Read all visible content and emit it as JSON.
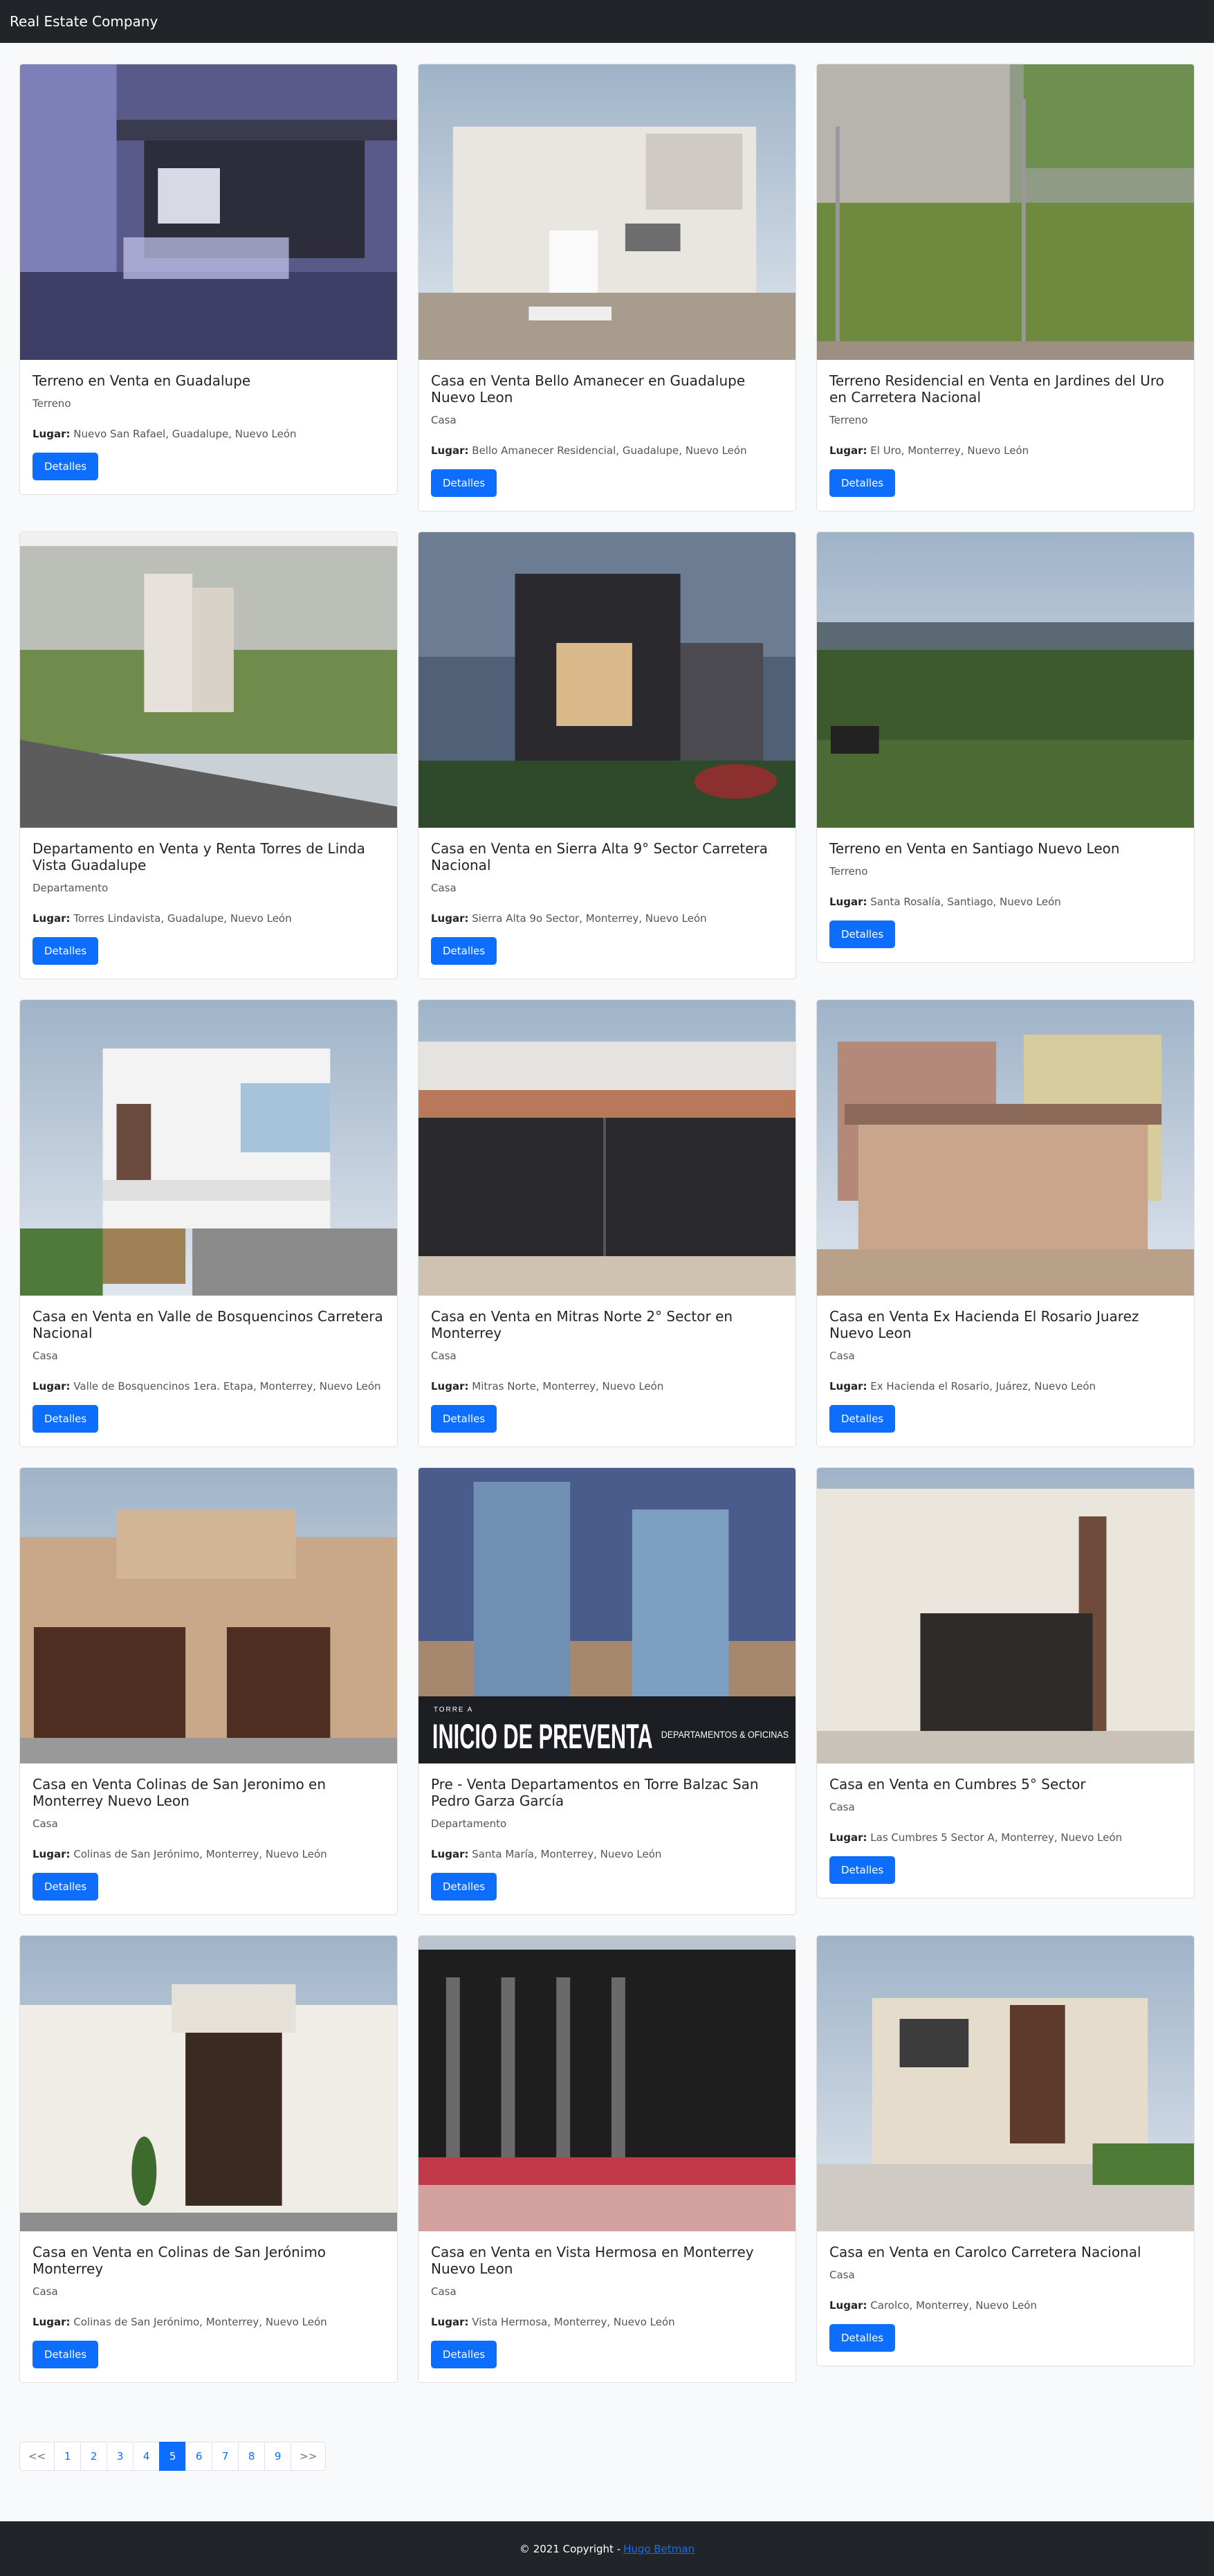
{
  "nav": {
    "brand": "Real Estate Company"
  },
  "card_labels": {
    "place_label": "Lugar:",
    "details_button": "Detalles"
  },
  "listings": [
    {
      "title": "Terreno en Venta en Guadalupe",
      "type": "Terreno",
      "place": "Nuevo San Rafael, Guadalupe, Nuevo León",
      "photo": "lot-warehouse"
    },
    {
      "title": "Casa en Venta Bello Amanecer en Guadalupe Nuevo Leon",
      "type": "Casa",
      "place": "Bello Amanecer Residencial, Guadalupe, Nuevo León",
      "photo": "house-modern-white"
    },
    {
      "title": "Terreno Residencial en Venta en Jardines del Uro en Carretera Nacional",
      "type": "Terreno",
      "place": "El Uro, Monterrey, Nuevo León",
      "photo": "lot-overgrown"
    },
    {
      "title": "Departamento en Venta y Renta Torres de Linda Vista Guadalupe",
      "type": "Departamento",
      "place": "Torres Lindavista, Guadalupe, Nuevo León",
      "photo": "aerial-towers"
    },
    {
      "title": "Casa en Venta en Sierra Alta 9° Sector Carretera Nacional",
      "type": "Casa",
      "place": "Sierra Alta 9o Sector, Monterrey, Nuevo León",
      "photo": "house-night-render"
    },
    {
      "title": "Terreno en Venta en Santiago Nuevo Leon",
      "type": "Terreno",
      "place": "Santa Rosalía, Santiago, Nuevo León",
      "photo": "lot-green-field"
    },
    {
      "title": "Casa en Venta en Valle de Bosquencinos Carretera Nacional",
      "type": "Casa",
      "place": "Valle de Bosquencinos 1era. Etapa, Monterrey, Nuevo León",
      "photo": "house-render-sky"
    },
    {
      "title": "Casa en Venta en Mitras Norte 2° Sector en Monterrey",
      "type": "Casa",
      "place": "Mitras Norte, Monterrey, Nuevo León",
      "photo": "house-garage-gate"
    },
    {
      "title": "Casa en Venta Ex Hacienda El Rosario Juarez Nuevo Leon",
      "type": "Casa",
      "place": "Ex Hacienda el Rosario, Juárez, Nuevo León",
      "photo": "house-small-two-story"
    },
    {
      "title": "Casa en Venta Colinas de San Jeronimo en Monterrey Nuevo Leon",
      "type": "Casa",
      "place": "Colinas de San Jerónimo, Monterrey, Nuevo León",
      "photo": "house-wood-doors"
    },
    {
      "title": "Pre - Venta Departamentos en Torre Balzac San Pedro Garza García",
      "type": "Departamento",
      "place": "Santa María, Monterrey, Nuevo León",
      "photo": "towers-presale",
      "overlay_small": "TORRE A",
      "overlay_big": "INICIO DE PREVENTA",
      "overlay_side": "DEPARTAMENTOS & OFICINAS"
    },
    {
      "title": "Casa en Venta en Cumbres 5° Sector",
      "type": "Casa",
      "place": "Las Cumbres 5 Sector A, Monterrey, Nuevo León",
      "photo": "house-white-garage"
    },
    {
      "title": "Casa en Venta en Colinas de San Jerónimo Monterrey",
      "type": "Casa",
      "place": "Colinas de San Jerónimo, Monterrey, Nuevo León",
      "photo": "house-white-colonial"
    },
    {
      "title": "Casa en Venta en Vista Hermosa en Monterrey Nuevo Leon",
      "type": "Casa",
      "place": "Vista Hermosa, Monterrey, Nuevo León",
      "photo": "black-gate"
    },
    {
      "title": "Casa en Venta en Carolco Carretera Nacional",
      "type": "Casa",
      "place": "Carolco, Monterrey, Nuevo León",
      "photo": "house-modern-beige"
    }
  ],
  "pagination": {
    "prev": "<<",
    "pages": [
      "1",
      "2",
      "3",
      "4",
      "5",
      "6",
      "7",
      "8",
      "9"
    ],
    "active": "5",
    "next": ">>"
  },
  "footer": {
    "copyright": "© 2021 Copyright -",
    "author": "Hugo Betman"
  }
}
